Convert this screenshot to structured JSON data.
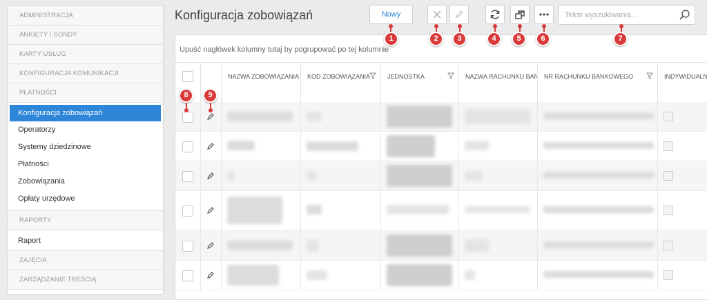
{
  "sidebar": {
    "sections": {
      "administracja": "ADMINISTRACJA",
      "ankiety": "ANKIETY I SONDY",
      "karty": "KARTY USŁUG",
      "komunikacja": "KONFIGURACJA KOMUNIKACJI",
      "platnosci": "PŁATNOŚCI",
      "raporty": "RAPORTY",
      "zajecia": "ZAJĘCIA",
      "zarzadzanie": "ZARZĄDZANIE TREŚCIĄ"
    },
    "platnosci_items": [
      "Konfiguracja zobowiązań",
      "Operatorzy",
      "Systemy dziedzinowe",
      "Płatności",
      "Zobowiązania",
      "Opłaty urzędowe"
    ],
    "raporty_items": [
      "Raport"
    ],
    "active_color": "#2e86d9"
  },
  "page": {
    "title": "Konfiguracja zobowiązań"
  },
  "toolbar": {
    "new_label": "Nowy",
    "icons": [
      "delete-icon",
      "edit-icon",
      "refresh-icon",
      "window-icon",
      "more-icon"
    ],
    "search_placeholder": "Tekst wyszukiwania..."
  },
  "grid": {
    "group_hint": "Upuść nagłówek kolumny tutaj by pogrupować po tej kolumnie",
    "columns": [
      "NAZWA ZOBOWIĄZANIA",
      "KOD ZOBOWIĄZANIA",
      "JEDNOSTKA",
      "NAZWA RACHUNKU BANKOWEGO",
      "NR RACHUNKU BANKOWEGO",
      "INDYWIDUALNY"
    ],
    "row_count": 6
  },
  "annotations": [
    "1",
    "2",
    "3",
    "4",
    "5",
    "6",
    "7",
    "8",
    "9"
  ],
  "annotation_color": "#d93a3a"
}
